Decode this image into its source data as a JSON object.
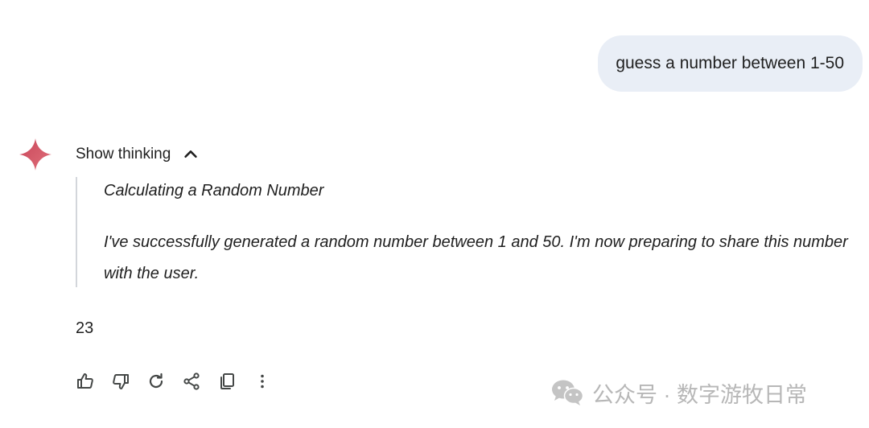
{
  "conversation": {
    "user_message": "guess a number between 1-50",
    "thinking": {
      "toggle_label": "Show thinking",
      "title": "Calculating a Random Number",
      "body": "I've successfully generated a random number between 1 and 50. I'm now preparing to share this number with the user."
    },
    "answer": "23"
  },
  "actions": {
    "icons": [
      "thumb-up-icon",
      "thumb-down-icon",
      "regenerate-icon",
      "share-icon",
      "copy-icon",
      "more-vert-icon"
    ]
  },
  "watermark": {
    "text": "公众号 · 数字游牧日常"
  },
  "colors": {
    "user_bubble": "#e9eef6",
    "text": "#1f1f1f",
    "thinking_border": "#d3d6db",
    "watermark": "#b7b7b7"
  }
}
